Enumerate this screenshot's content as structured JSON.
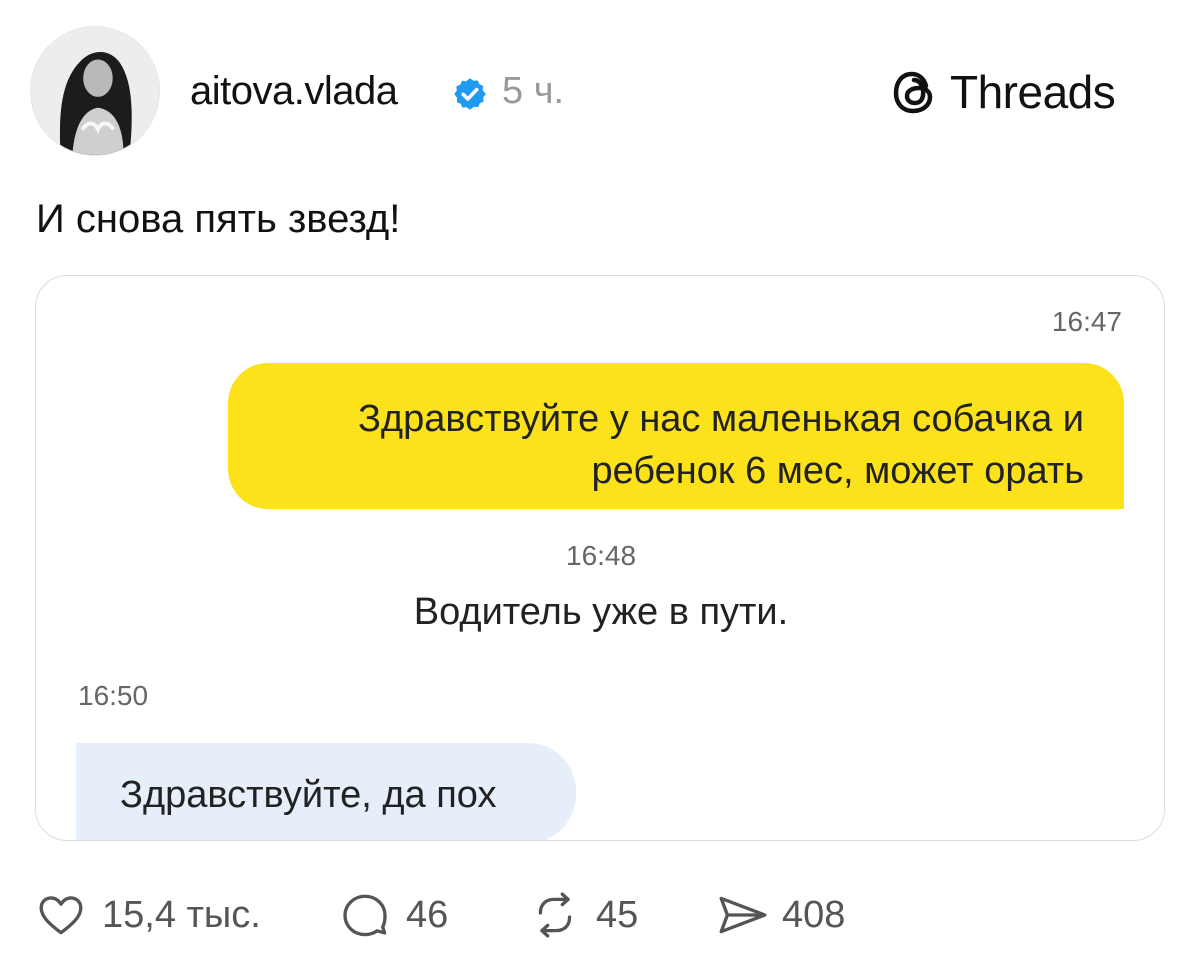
{
  "post": {
    "username": "aitova.vlada",
    "time_ago": "5 ч.",
    "brand": "Threads",
    "text": "И снова пять звезд!"
  },
  "chat": {
    "time_1": "16:47",
    "message_1": "Здравствуйте у нас маленькая собачка и ребенок 6 мес, может орать",
    "time_2": "16:48",
    "status_message": "Водитель уже в пути.",
    "time_3": "16:50",
    "message_2": "Здравствуйте, да пох"
  },
  "actions": {
    "likes": "15,4 тыс.",
    "comments": "46",
    "reposts": "45",
    "shares": "408"
  },
  "colors": {
    "yellow_bubble": "#fce21b",
    "blue_bubble": "#e5eef9",
    "verified_badge": "#1d9bf0"
  },
  "icons": [
    "verified-badge-icon",
    "threads-logo-icon",
    "heart-icon",
    "comment-icon",
    "repost-icon",
    "share-icon"
  ]
}
